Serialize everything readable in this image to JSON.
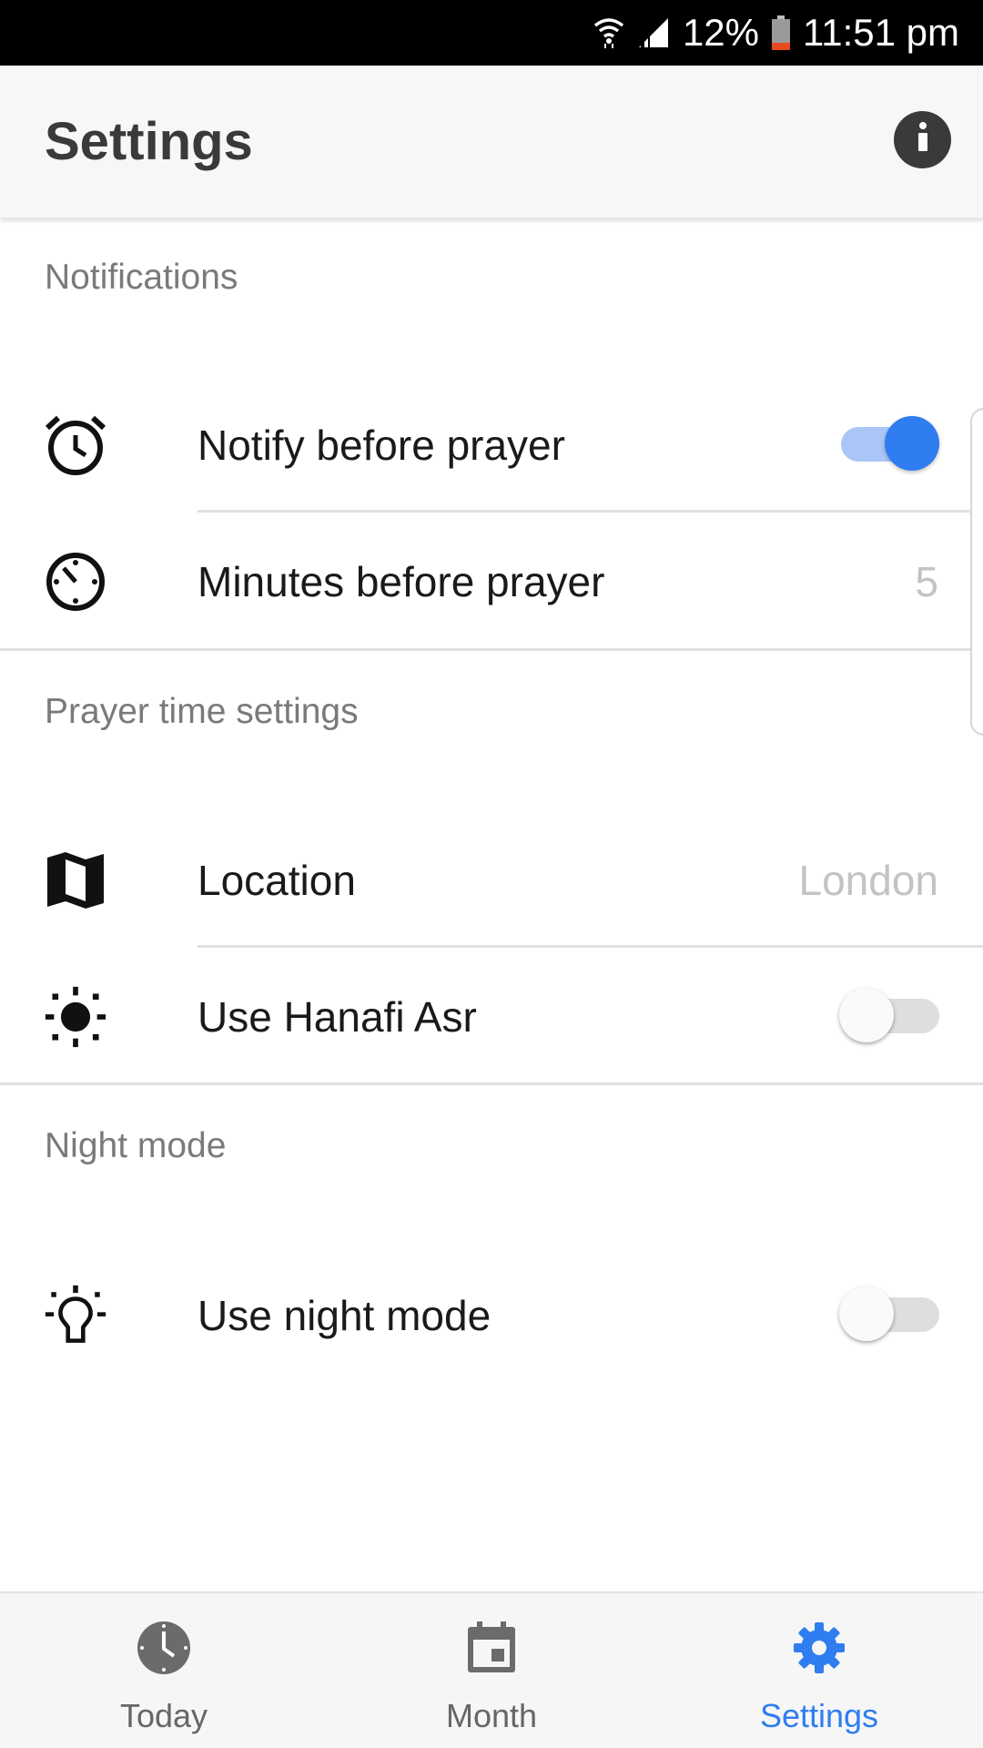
{
  "status_bar": {
    "battery_percent": "12%",
    "time": "11:51 pm",
    "icons": [
      "wifi-icon",
      "cell-signal-icon",
      "battery-icon"
    ],
    "battery_color": "#e8491d"
  },
  "app_bar": {
    "title": "Settings",
    "info_icon": "info-icon"
  },
  "sections": {
    "notifications": {
      "header": "Notifications",
      "notify_before_prayer": {
        "label": "Notify before prayer",
        "icon": "alarm-clock-icon",
        "enabled": true
      },
      "minutes_before_prayer": {
        "label": "Minutes before prayer",
        "value": "5",
        "icon": "timer-icon"
      }
    },
    "prayer_time": {
      "header": "Prayer time settings",
      "location": {
        "label": "Location",
        "value": "London",
        "icon": "map-icon"
      },
      "hanafi_asr": {
        "label": "Use Hanafi Asr",
        "icon": "sun-icon",
        "enabled": false
      }
    },
    "night_mode": {
      "header": "Night mode",
      "use_night_mode": {
        "label": "Use night mode",
        "icon": "lightbulb-icon",
        "enabled": false
      }
    }
  },
  "bottom_nav": {
    "items": [
      {
        "label": "Today",
        "icon": "clock-icon",
        "active": false
      },
      {
        "label": "Month",
        "icon": "calendar-icon",
        "active": false
      },
      {
        "label": "Settings",
        "icon": "gear-icon",
        "active": true
      }
    ]
  },
  "colors": {
    "accent": "#2f7df0",
    "toggle_track_on": "#a9c6f7",
    "section_header": "#7a7a7a",
    "value_text": "#c3c3c3"
  }
}
